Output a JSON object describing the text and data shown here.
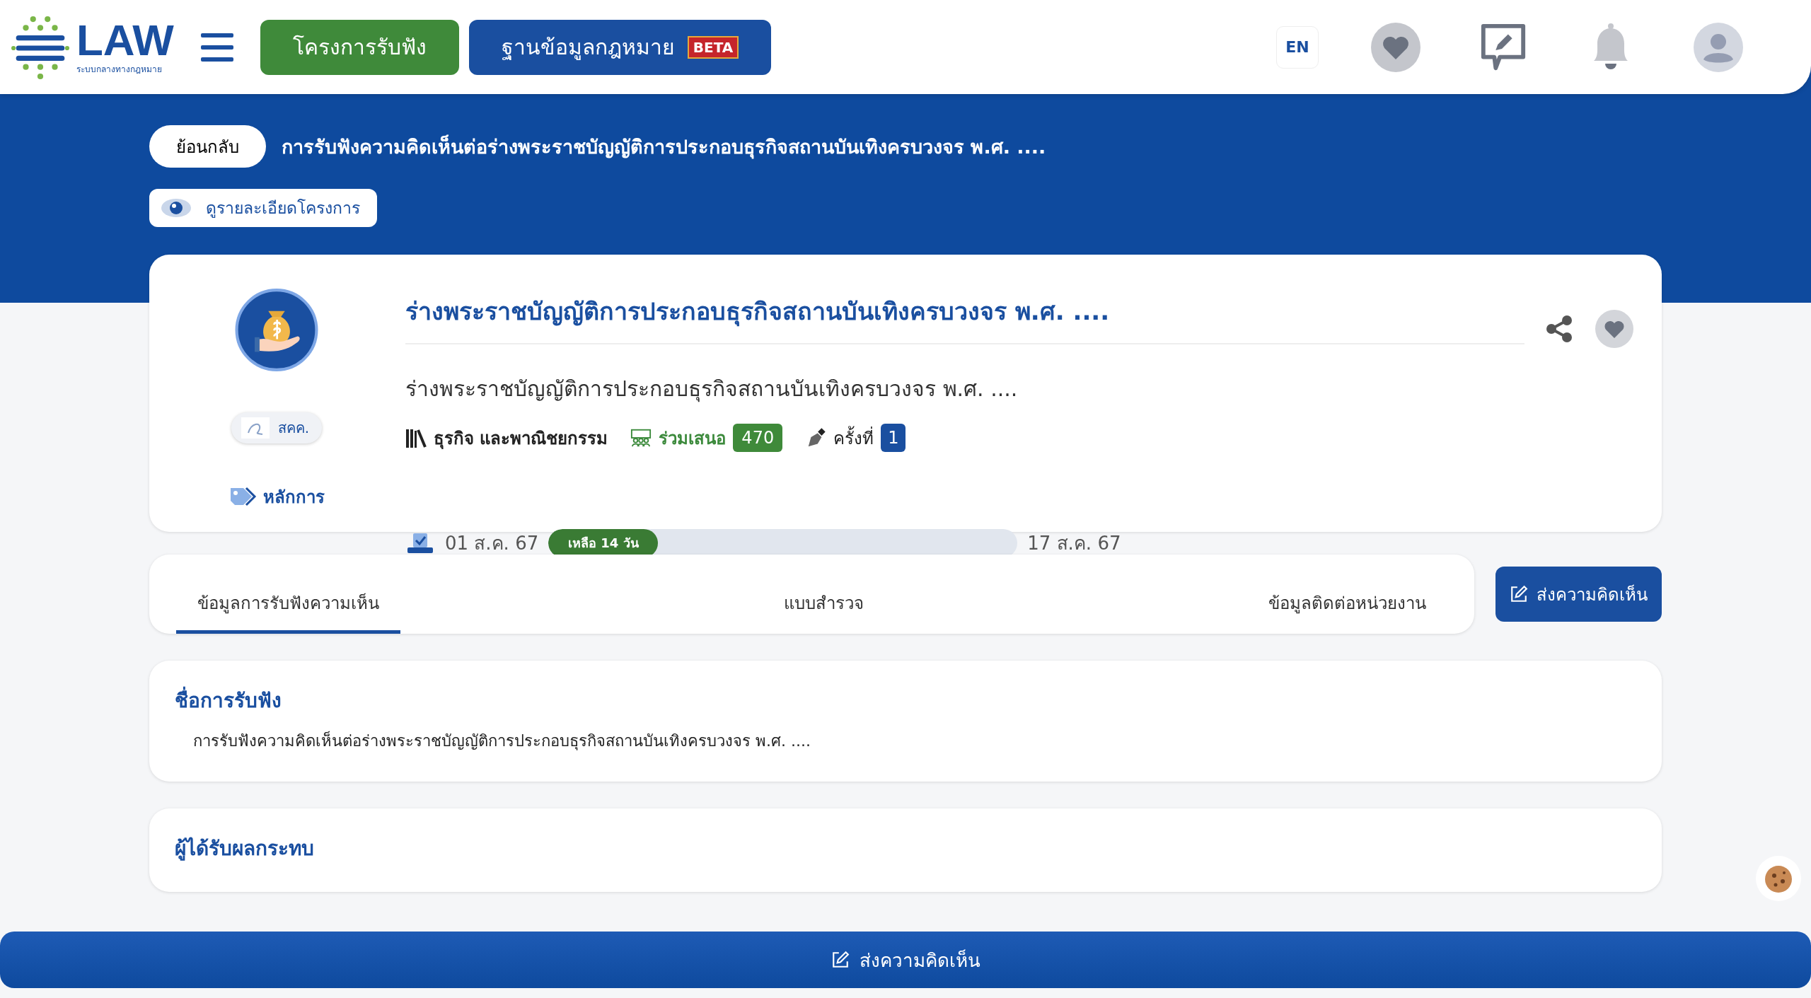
{
  "header": {
    "logo": {
      "title": "LAW",
      "subtitle": "ระบบกลางทางกฎหมาย"
    },
    "nav": [
      {
        "label": "โครงการรับฟัง",
        "kind": "green"
      },
      {
        "label": "ฐานข้อมูลกฎหมาย",
        "kind": "blue",
        "badge": "BETA"
      }
    ],
    "language": "EN"
  },
  "breadcrumb": {
    "back": "ย้อนกลับ",
    "title": "การรับฟังความคิดเห็นต่อร่างพระราชบัญญัติการประกอบธุรกิจสถานบันเทิงครบวงจร พ.ศ. ....",
    "details_button": "ดูรายละเอียดโครงการ"
  },
  "project": {
    "title": "ร่างพระราชบัญญัติการประกอบธุรกิจสถานบันเทิงครบวงจร พ.ศ. ....",
    "subtitle": "ร่างพระราชบัญญัติการประกอบธุรกิจสถานบันเทิงครบวงจร พ.ศ. ....",
    "category": "ธุรกิจ และพาณิชยกรรม",
    "participants_label": "ร่วมเสนอ",
    "participants": "470",
    "round_label": "ครั้งที่",
    "round": "1",
    "agency": "สคค.",
    "principle": "หลักการ",
    "start_date": "01 ส.ค. 67",
    "remaining": "เหลือ 14 วัน",
    "level": 0.234,
    "end_date": "17 ส.ค. 67"
  },
  "tabs": [
    {
      "label": "ข้อมูลการรับฟังความเห็น",
      "selected": true
    },
    {
      "label": "แบบสำรวจ",
      "selected": false
    },
    {
      "label": "ข้อมูลติดต่อหน่วยงาน",
      "selected": false
    }
  ],
  "comment_button": "ส่งความคิดเห็น",
  "sections": [
    {
      "heading": "ชื่อการรับฟัง",
      "text": "การรับฟังความคิดเห็นต่อร่างพระราชบัญญัติการประกอบธุรกิจสถานบันเทิงครบวงจร พ.ศ. ...."
    },
    {
      "heading": "ผู้ได้รับผลกระทบ"
    }
  ],
  "bottom_button": "ส่งความคิดเห็น"
}
